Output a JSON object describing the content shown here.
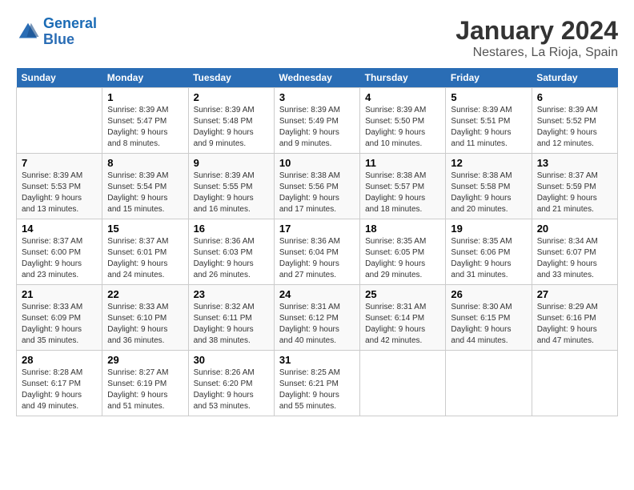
{
  "header": {
    "logo_general": "General",
    "logo_blue": "Blue",
    "title": "January 2024",
    "location": "Nestares, La Rioja, Spain"
  },
  "weekdays": [
    "Sunday",
    "Monday",
    "Tuesday",
    "Wednesday",
    "Thursday",
    "Friday",
    "Saturday"
  ],
  "weeks": [
    [
      {
        "day": "",
        "info": ""
      },
      {
        "day": "1",
        "info": "Sunrise: 8:39 AM\nSunset: 5:47 PM\nDaylight: 9 hours\nand 8 minutes."
      },
      {
        "day": "2",
        "info": "Sunrise: 8:39 AM\nSunset: 5:48 PM\nDaylight: 9 hours\nand 9 minutes."
      },
      {
        "day": "3",
        "info": "Sunrise: 8:39 AM\nSunset: 5:49 PM\nDaylight: 9 hours\nand 9 minutes."
      },
      {
        "day": "4",
        "info": "Sunrise: 8:39 AM\nSunset: 5:50 PM\nDaylight: 9 hours\nand 10 minutes."
      },
      {
        "day": "5",
        "info": "Sunrise: 8:39 AM\nSunset: 5:51 PM\nDaylight: 9 hours\nand 11 minutes."
      },
      {
        "day": "6",
        "info": "Sunrise: 8:39 AM\nSunset: 5:52 PM\nDaylight: 9 hours\nand 12 minutes."
      }
    ],
    [
      {
        "day": "7",
        "info": "Sunrise: 8:39 AM\nSunset: 5:53 PM\nDaylight: 9 hours\nand 13 minutes."
      },
      {
        "day": "8",
        "info": "Sunrise: 8:39 AM\nSunset: 5:54 PM\nDaylight: 9 hours\nand 15 minutes."
      },
      {
        "day": "9",
        "info": "Sunrise: 8:39 AM\nSunset: 5:55 PM\nDaylight: 9 hours\nand 16 minutes."
      },
      {
        "day": "10",
        "info": "Sunrise: 8:38 AM\nSunset: 5:56 PM\nDaylight: 9 hours\nand 17 minutes."
      },
      {
        "day": "11",
        "info": "Sunrise: 8:38 AM\nSunset: 5:57 PM\nDaylight: 9 hours\nand 18 minutes."
      },
      {
        "day": "12",
        "info": "Sunrise: 8:38 AM\nSunset: 5:58 PM\nDaylight: 9 hours\nand 20 minutes."
      },
      {
        "day": "13",
        "info": "Sunrise: 8:37 AM\nSunset: 5:59 PM\nDaylight: 9 hours\nand 21 minutes."
      }
    ],
    [
      {
        "day": "14",
        "info": "Sunrise: 8:37 AM\nSunset: 6:00 PM\nDaylight: 9 hours\nand 23 minutes."
      },
      {
        "day": "15",
        "info": "Sunrise: 8:37 AM\nSunset: 6:01 PM\nDaylight: 9 hours\nand 24 minutes."
      },
      {
        "day": "16",
        "info": "Sunrise: 8:36 AM\nSunset: 6:03 PM\nDaylight: 9 hours\nand 26 minutes."
      },
      {
        "day": "17",
        "info": "Sunrise: 8:36 AM\nSunset: 6:04 PM\nDaylight: 9 hours\nand 27 minutes."
      },
      {
        "day": "18",
        "info": "Sunrise: 8:35 AM\nSunset: 6:05 PM\nDaylight: 9 hours\nand 29 minutes."
      },
      {
        "day": "19",
        "info": "Sunrise: 8:35 AM\nSunset: 6:06 PM\nDaylight: 9 hours\nand 31 minutes."
      },
      {
        "day": "20",
        "info": "Sunrise: 8:34 AM\nSunset: 6:07 PM\nDaylight: 9 hours\nand 33 minutes."
      }
    ],
    [
      {
        "day": "21",
        "info": "Sunrise: 8:33 AM\nSunset: 6:09 PM\nDaylight: 9 hours\nand 35 minutes."
      },
      {
        "day": "22",
        "info": "Sunrise: 8:33 AM\nSunset: 6:10 PM\nDaylight: 9 hours\nand 36 minutes."
      },
      {
        "day": "23",
        "info": "Sunrise: 8:32 AM\nSunset: 6:11 PM\nDaylight: 9 hours\nand 38 minutes."
      },
      {
        "day": "24",
        "info": "Sunrise: 8:31 AM\nSunset: 6:12 PM\nDaylight: 9 hours\nand 40 minutes."
      },
      {
        "day": "25",
        "info": "Sunrise: 8:31 AM\nSunset: 6:14 PM\nDaylight: 9 hours\nand 42 minutes."
      },
      {
        "day": "26",
        "info": "Sunrise: 8:30 AM\nSunset: 6:15 PM\nDaylight: 9 hours\nand 44 minutes."
      },
      {
        "day": "27",
        "info": "Sunrise: 8:29 AM\nSunset: 6:16 PM\nDaylight: 9 hours\nand 47 minutes."
      }
    ],
    [
      {
        "day": "28",
        "info": "Sunrise: 8:28 AM\nSunset: 6:17 PM\nDaylight: 9 hours\nand 49 minutes."
      },
      {
        "day": "29",
        "info": "Sunrise: 8:27 AM\nSunset: 6:19 PM\nDaylight: 9 hours\nand 51 minutes."
      },
      {
        "day": "30",
        "info": "Sunrise: 8:26 AM\nSunset: 6:20 PM\nDaylight: 9 hours\nand 53 minutes."
      },
      {
        "day": "31",
        "info": "Sunrise: 8:25 AM\nSunset: 6:21 PM\nDaylight: 9 hours\nand 55 minutes."
      },
      {
        "day": "",
        "info": ""
      },
      {
        "day": "",
        "info": ""
      },
      {
        "day": "",
        "info": ""
      }
    ]
  ]
}
